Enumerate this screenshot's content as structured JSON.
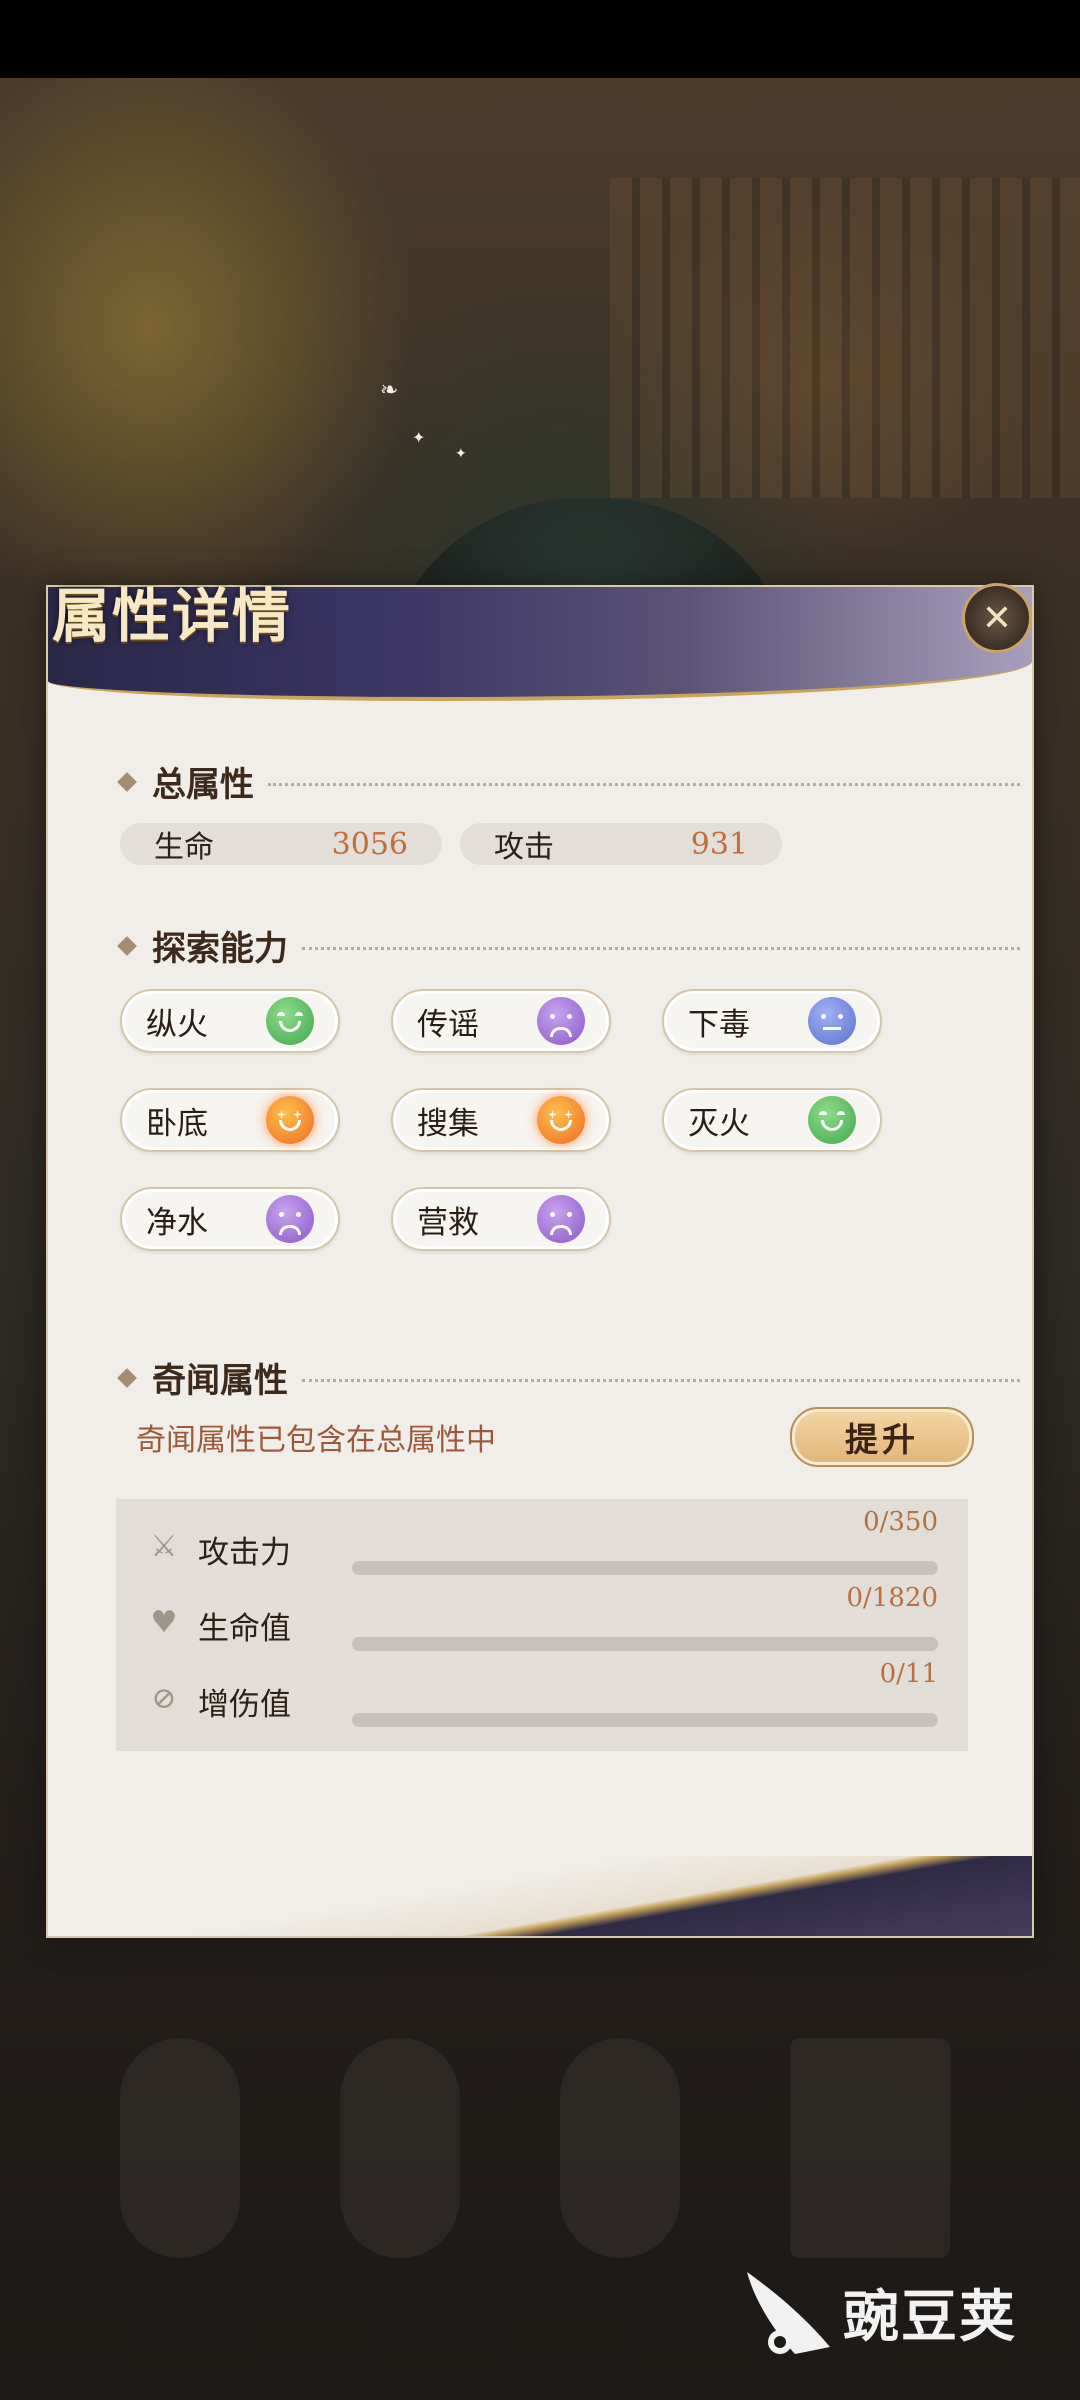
{
  "panel": {
    "title": "属性详情",
    "close_icon": "✕"
  },
  "total_attributes": {
    "label": "总属性",
    "stats": [
      {
        "name": "生命",
        "value": "3056"
      },
      {
        "name": "攻击",
        "value": "931"
      }
    ]
  },
  "exploration": {
    "label": "探索能力",
    "abilities": [
      {
        "name": "纵火",
        "mood": "happy",
        "color": "#4caf50"
      },
      {
        "name": "传谣",
        "mood": "sad",
        "color": "#9a66d6"
      },
      {
        "name": "下毒",
        "mood": "neutral",
        "color": "#6478d8"
      },
      {
        "name": "卧底",
        "mood": "excited",
        "color": "#f07a2a"
      },
      {
        "name": "搜集",
        "mood": "excited",
        "color": "#f07a2a"
      },
      {
        "name": "灭火",
        "mood": "happy",
        "color": "#4caf50"
      },
      {
        "name": "净水",
        "mood": "sad",
        "color": "#9a66d6"
      },
      {
        "name": "营救",
        "mood": "sad",
        "color": "#9a66d6"
      }
    ]
  },
  "qiwen": {
    "label": "奇闻属性",
    "description": "奇闻属性已包含在总属性中",
    "raise_button": "提升",
    "bonuses": [
      {
        "name": "攻击力",
        "value": "0/350",
        "progress": 0,
        "icon": "sword-icon"
      },
      {
        "name": "生命值",
        "value": "0/1820",
        "progress": 0,
        "icon": "heart-plus-icon"
      },
      {
        "name": "增伤值",
        "value": "0/11",
        "progress": 0,
        "icon": "damage-up-icon"
      }
    ]
  },
  "watermark": {
    "text": "豌豆荚"
  }
}
